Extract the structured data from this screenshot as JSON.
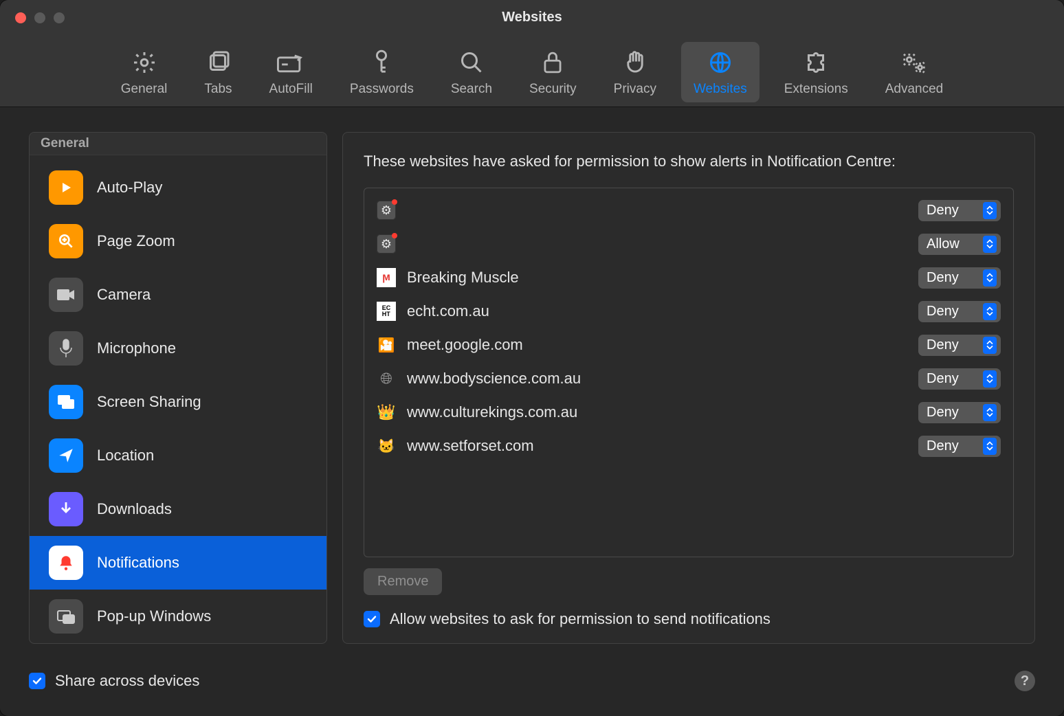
{
  "window": {
    "title": "Websites"
  },
  "toolbar": {
    "items": [
      {
        "label": "General",
        "icon": "gear-icon",
        "active": false
      },
      {
        "label": "Tabs",
        "icon": "tabs-icon",
        "active": false
      },
      {
        "label": "AutoFill",
        "icon": "autofill-icon",
        "active": false
      },
      {
        "label": "Passwords",
        "icon": "key-icon",
        "active": false
      },
      {
        "label": "Search",
        "icon": "search-icon",
        "active": false
      },
      {
        "label": "Security",
        "icon": "lock-icon",
        "active": false
      },
      {
        "label": "Privacy",
        "icon": "hand-icon",
        "active": false
      },
      {
        "label": "Websites",
        "icon": "globe-icon",
        "active": true
      },
      {
        "label": "Extensions",
        "icon": "puzzle-icon",
        "active": false
      },
      {
        "label": "Advanced",
        "icon": "gears-icon",
        "active": false
      }
    ]
  },
  "sidebar": {
    "header": "General",
    "items": [
      {
        "label": "Auto-Play",
        "icon": "play-icon",
        "bg": "#ff9800",
        "selected": false
      },
      {
        "label": "Page Zoom",
        "icon": "zoom-icon",
        "bg": "#ff9800",
        "selected": false
      },
      {
        "label": "Camera",
        "icon": "camera-icon",
        "bg": "#4a4a4a",
        "selected": false
      },
      {
        "label": "Microphone",
        "icon": "microphone-icon",
        "bg": "#4a4a4a",
        "selected": false
      },
      {
        "label": "Screen Sharing",
        "icon": "screenshare-icon",
        "bg": "#0a84ff",
        "selected": false
      },
      {
        "label": "Location",
        "icon": "location-icon",
        "bg": "#0a84ff",
        "selected": false
      },
      {
        "label": "Downloads",
        "icon": "download-icon",
        "bg": "#6a5cff",
        "selected": false
      },
      {
        "label": "Notifications",
        "icon": "bell-icon",
        "bg": "#ffffff",
        "selected": true
      },
      {
        "label": "Pop-up Windows",
        "icon": "popup-icon",
        "bg": "#4a4a4a",
        "selected": false
      }
    ]
  },
  "panel": {
    "description": "These websites have asked for permission to show alerts in Notification Centre:",
    "options": [
      "Allow",
      "Deny"
    ],
    "sites": [
      {
        "name": "",
        "favicon": "sysprefs-icon",
        "value": "Deny"
      },
      {
        "name": "",
        "favicon": "sysprefs-icon",
        "value": "Allow"
      },
      {
        "name": "Breaking Muscle",
        "favicon": "bm-icon",
        "value": "Deny"
      },
      {
        "name": "echt.com.au",
        "favicon": "echt-icon",
        "value": "Deny"
      },
      {
        "name": "meet.google.com",
        "favicon": "meet-icon",
        "value": "Deny"
      },
      {
        "name": "www.bodyscience.com.au",
        "favicon": "globe-icon",
        "value": "Deny"
      },
      {
        "name": "www.culturekings.com.au",
        "favicon": "ck-icon",
        "value": "Deny"
      },
      {
        "name": "www.setforset.com",
        "favicon": "sfs-icon",
        "value": "Deny"
      }
    ],
    "remove_label": "Remove",
    "allow_ask_checked": true,
    "allow_ask_label": "Allow websites to ask for permission to send notifications"
  },
  "footer": {
    "share_checked": true,
    "share_label": "Share across devices",
    "help_label": "?"
  }
}
